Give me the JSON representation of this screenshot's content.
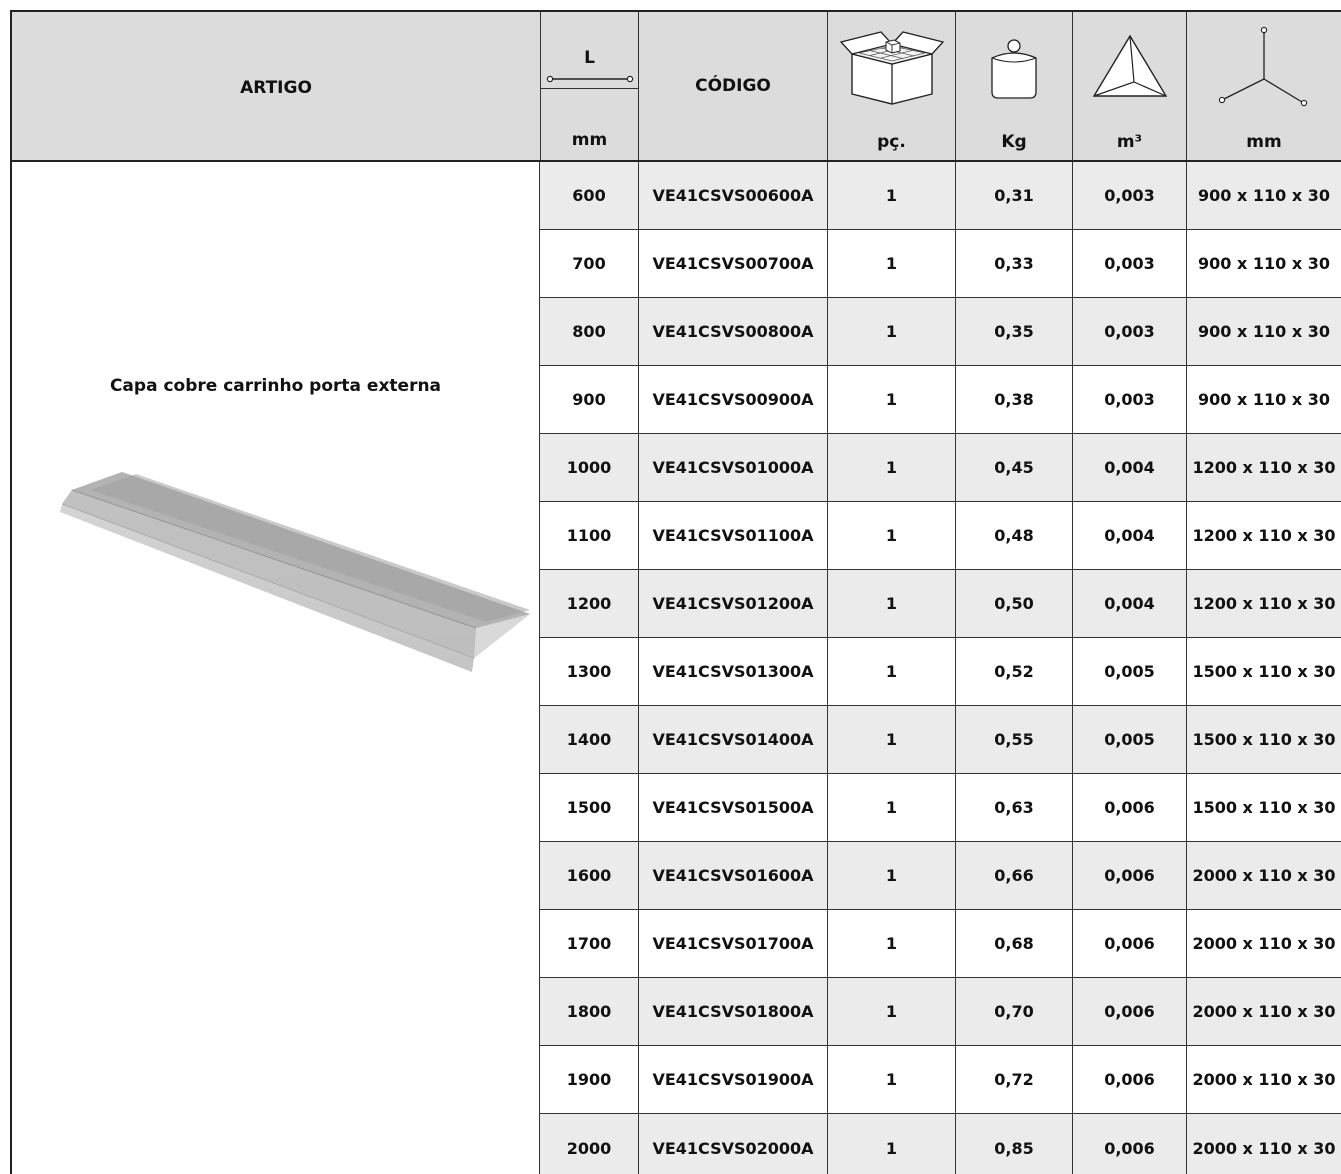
{
  "header": {
    "artigo": "ARTIGO",
    "length": {
      "top": "L",
      "unit": "mm"
    },
    "codigo": "CÓDIGO",
    "pieces": {
      "unit": "pç."
    },
    "weight": {
      "unit": "Kg"
    },
    "volume": {
      "unit": "m³"
    },
    "dimensions": {
      "unit": "mm"
    }
  },
  "icons": {
    "length": "length-ruler-icon",
    "pieces": "open-box-icon",
    "weight": "weight-jar-icon",
    "volume": "pyramid-volume-icon",
    "dimensions": "three-axis-dimensions-icon"
  },
  "article": {
    "name": "Capa cobre carrinho porta externa",
    "image": "aluminium-profile-cover"
  },
  "rows": [
    {
      "length": "600",
      "code": "VE41CSVS00600A",
      "pieces": "1",
      "weight": "0,31",
      "volume": "0,003",
      "dimensions": "900 x 110 x 30"
    },
    {
      "length": "700",
      "code": "VE41CSVS00700A",
      "pieces": "1",
      "weight": "0,33",
      "volume": "0,003",
      "dimensions": "900 x 110 x 30"
    },
    {
      "length": "800",
      "code": "VE41CSVS00800A",
      "pieces": "1",
      "weight": "0,35",
      "volume": "0,003",
      "dimensions": "900 x 110 x 30"
    },
    {
      "length": "900",
      "code": "VE41CSVS00900A",
      "pieces": "1",
      "weight": "0,38",
      "volume": "0,003",
      "dimensions": "900 x 110 x 30"
    },
    {
      "length": "1000",
      "code": "VE41CSVS01000A",
      "pieces": "1",
      "weight": "0,45",
      "volume": "0,004",
      "dimensions": "1200 x 110 x 30"
    },
    {
      "length": "1100",
      "code": "VE41CSVS01100A",
      "pieces": "1",
      "weight": "0,48",
      "volume": "0,004",
      "dimensions": "1200 x 110 x 30"
    },
    {
      "length": "1200",
      "code": "VE41CSVS01200A",
      "pieces": "1",
      "weight": "0,50",
      "volume": "0,004",
      "dimensions": "1200 x 110 x 30"
    },
    {
      "length": "1300",
      "code": "VE41CSVS01300A",
      "pieces": "1",
      "weight": "0,52",
      "volume": "0,005",
      "dimensions": "1500 x 110 x 30"
    },
    {
      "length": "1400",
      "code": "VE41CSVS01400A",
      "pieces": "1",
      "weight": "0,55",
      "volume": "0,005",
      "dimensions": "1500 x 110 x 30"
    },
    {
      "length": "1500",
      "code": "VE41CSVS01500A",
      "pieces": "1",
      "weight": "0,63",
      "volume": "0,006",
      "dimensions": "1500 x 110 x 30"
    },
    {
      "length": "1600",
      "code": "VE41CSVS01600A",
      "pieces": "1",
      "weight": "0,66",
      "volume": "0,006",
      "dimensions": "2000 x 110 x 30"
    },
    {
      "length": "1700",
      "code": "VE41CSVS01700A",
      "pieces": "1",
      "weight": "0,68",
      "volume": "0,006",
      "dimensions": "2000 x 110 x 30"
    },
    {
      "length": "1800",
      "code": "VE41CSVS01800A",
      "pieces": "1",
      "weight": "0,70",
      "volume": "0,006",
      "dimensions": "2000 x 110 x 30"
    },
    {
      "length": "1900",
      "code": "VE41CSVS01900A",
      "pieces": "1",
      "weight": "0,72",
      "volume": "0,006",
      "dimensions": "2000 x 110 x 30"
    },
    {
      "length": "2000",
      "code": "VE41CSVS02000A",
      "pieces": "1",
      "weight": "0,85",
      "volume": "0,006",
      "dimensions": "2000 x 110 x 30"
    }
  ]
}
